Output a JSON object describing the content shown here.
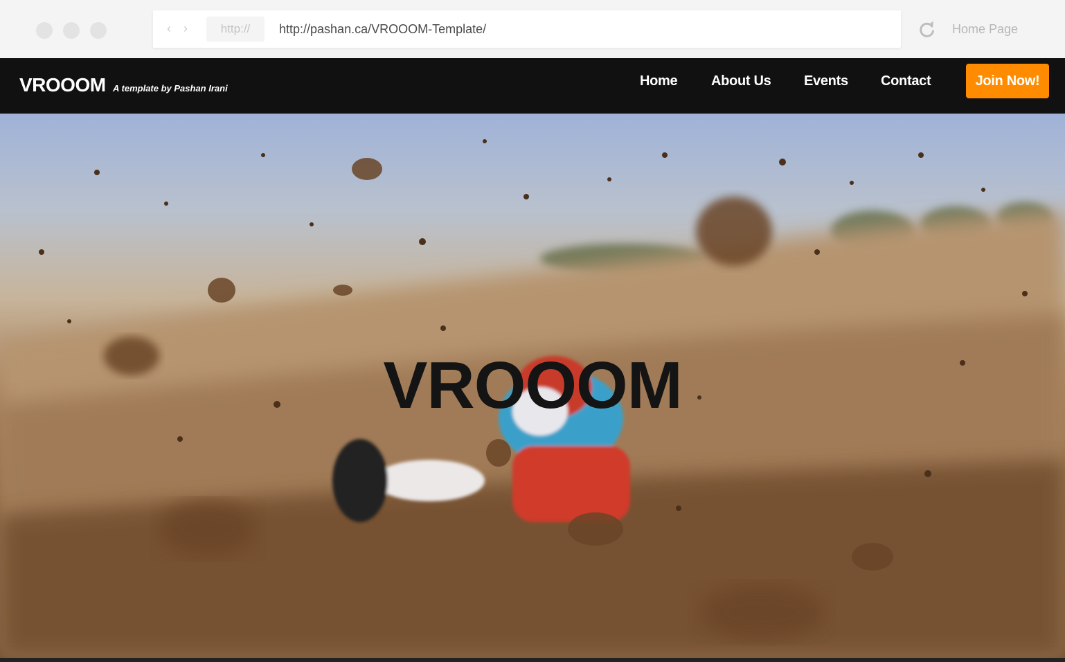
{
  "browser": {
    "protocol_label": "http://",
    "url": "http://pashan.ca/VROOOM-Template/",
    "home_label": "Home Page",
    "icons": [
      "back-arrow-icon",
      "forward-arrow-icon",
      "reload-icon"
    ]
  },
  "site": {
    "brand": "VROOOM",
    "tagline": "A template by Pashan Irani",
    "nav": {
      "home": "Home",
      "about": "About Us",
      "events": "Events",
      "contact": "Contact"
    },
    "cta": "Join Now!",
    "colors": {
      "nav_bg": "#111111",
      "cta_bg": "#ff8c00"
    }
  },
  "hero": {
    "title": "VROOOM"
  }
}
